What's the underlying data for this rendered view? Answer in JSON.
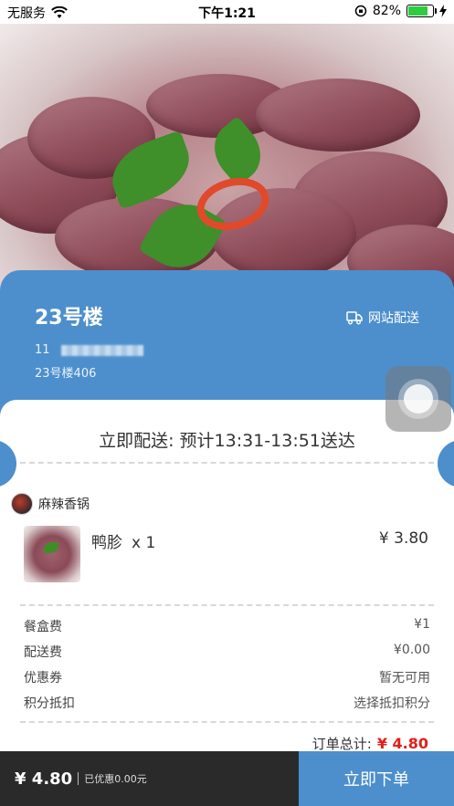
{
  "status_bar": {
    "carrier": "无服务",
    "time": "下午1:21",
    "battery_percent": "82%",
    "battery_level": 0.82,
    "icons": [
      "wifi-icon",
      "orientation-lock-icon",
      "battery-icon",
      "charging-icon"
    ]
  },
  "address_card": {
    "building": "23号楼",
    "delivery_mode": "网站配送",
    "contact_name": "11",
    "address": "23号楼406"
  },
  "order": {
    "eta": "立即配送: 预计13:31-13:51送达",
    "shop_name": "麻辣香锅",
    "items": [
      {
        "name": "鸭胗",
        "qty": "x 1",
        "price": "¥ 3.80"
      }
    ],
    "fees": [
      {
        "label": "餐盒费",
        "value": "¥1"
      },
      {
        "label": "配送费",
        "value": "¥0.00"
      },
      {
        "label": "优惠券",
        "value": "暂无可用"
      },
      {
        "label": "积分抵扣",
        "value": "选择抵扣积分"
      }
    ],
    "total_label": "订单总计:",
    "total_value": "¥ 4.80"
  },
  "bottom_bar": {
    "price": "¥ 4.80",
    "discount": "已优惠0.00元",
    "submit_label": "立即下单"
  },
  "colors": {
    "accent_blue": "#4d8fcc",
    "price_red": "#e0201c",
    "bottom_dark": "#2a2a2a"
  }
}
